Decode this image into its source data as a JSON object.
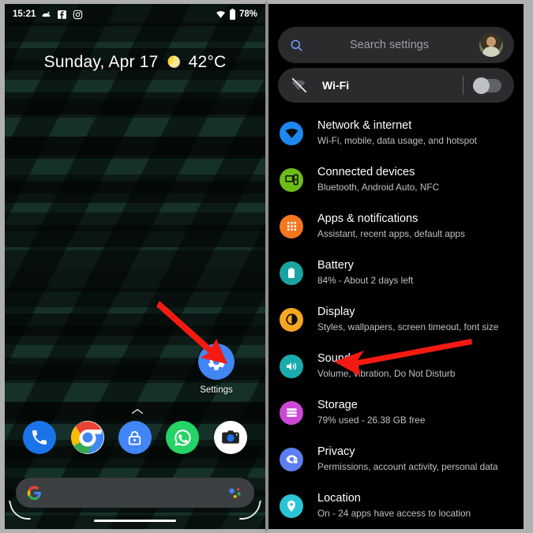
{
  "left_phone": {
    "status_bar": {
      "time": "15:21",
      "icons": [
        "reddit-icon",
        "facebook-messenger-icon",
        "instagram-icon"
      ],
      "wifi_icon": "wifi-icon",
      "battery_icon": "battery-icon",
      "battery_percent": "78%"
    },
    "clock_widget": {
      "date": "Sunday, Apr 17",
      "weather_icon": "sunny-icon",
      "temperature": "42°C"
    },
    "app": {
      "icon": "settings-gear-icon",
      "label": "Settings",
      "color": "#4285f4"
    },
    "dock": [
      {
        "name": "phone-icon",
        "label": "Phone",
        "color": "#1a73e8"
      },
      {
        "name": "chrome-icon",
        "label": "Chrome",
        "color": "#ffffff"
      },
      {
        "name": "lock-icon",
        "label": "Password Manager",
        "color": "#4285f4"
      },
      {
        "name": "whatsapp-icon",
        "label": "WhatsApp",
        "color": "#25d366"
      },
      {
        "name": "camera-icon",
        "label": "Camera",
        "color": "#ffffff"
      }
    ],
    "search_pill": {
      "google_icon": "google-g-icon",
      "assistant_icon": "google-assistant-icon",
      "value": "",
      "placeholder": ""
    },
    "nav_bar": {
      "home_indicator": "home-pill-indicator"
    }
  },
  "right_phone": {
    "search": {
      "icon": "search-icon",
      "placeholder": "Search settings",
      "value": "",
      "avatar": "user-avatar"
    },
    "wifi_row": {
      "icon": "wifi-off-icon",
      "label": "Wi-Fi",
      "toggle_state": "off"
    },
    "items": [
      {
        "icon": "wifi-icon",
        "color": "#1e88f0",
        "title": "Network & internet",
        "subtitle": "Wi-Fi, mobile, data usage, and hotspot"
      },
      {
        "icon": "connected-devices-icon",
        "color": "#6dbd19",
        "title": "Connected devices",
        "subtitle": "Bluetooth, Android Auto, NFC"
      },
      {
        "icon": "apps-grid-icon",
        "color": "#f4771e",
        "title": "Apps & notifications",
        "subtitle": "Assistant, recent apps, default apps"
      },
      {
        "icon": "battery-icon",
        "color": "#1aa3a3",
        "title": "Battery",
        "subtitle": "84% - About 2 days left"
      },
      {
        "icon": "brightness-icon",
        "color": "#f5a623",
        "title": "Display",
        "subtitle": "Styles, wallpapers, screen timeout, font size"
      },
      {
        "icon": "volume-icon",
        "color": "#1aacac",
        "title": "Sound",
        "subtitle": "Volume, vibration, Do Not Disturb"
      },
      {
        "icon": "storage-icon",
        "color": "#cb47d6",
        "title": "Storage",
        "subtitle": "79% used - 26.38 GB free"
      },
      {
        "icon": "privacy-eye-lock-icon",
        "color": "#5b7ef0",
        "title": "Privacy",
        "subtitle": "Permissions, account activity, personal data"
      },
      {
        "icon": "location-pin-icon",
        "color": "#2bc4d6",
        "title": "Location",
        "subtitle": "On - 24 apps have access to location"
      }
    ]
  },
  "annotations": {
    "arrow_color": "#f51a11",
    "arrow_left_target": "Settings",
    "arrow_right_target": "Sound"
  }
}
